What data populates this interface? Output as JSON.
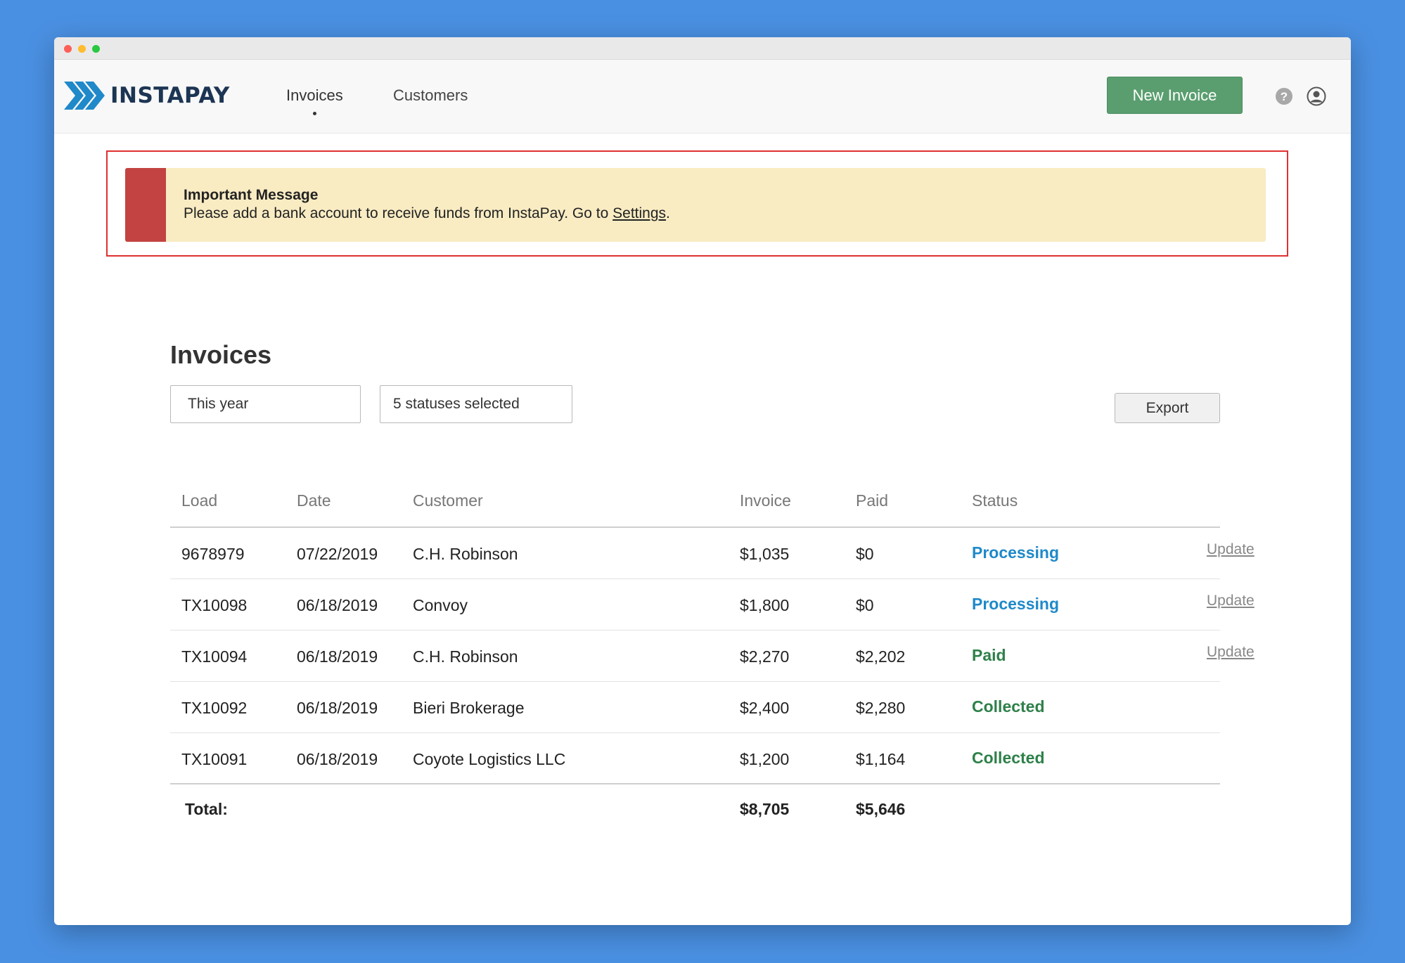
{
  "app": {
    "logo_text": "INSTAPAY",
    "brand_color": "#1c3553",
    "logo_arrow_color": "#1f89c9"
  },
  "nav": {
    "items": [
      {
        "label": "Invoices",
        "active": true
      },
      {
        "label": "Customers",
        "active": false
      }
    ]
  },
  "header": {
    "new_invoice_label": "New Invoice",
    "new_invoice_color": "#5a9e6f",
    "help_icon": "question-circle-icon",
    "user_icon": "user-circle-icon"
  },
  "alert": {
    "title": "Important Message",
    "body_prefix": "Please add a bank account to receive funds from InstaPay. Go to ",
    "link_text": "Settings",
    "body_suffix": ".",
    "accent_color": "#c24341",
    "background_color": "#f9ecc3"
  },
  "invoices": {
    "title": "Invoices",
    "filters": {
      "date_range": "This year",
      "statuses": "5 statuses selected"
    },
    "export_label": "Export",
    "columns": {
      "load": "Load",
      "date": "Date",
      "customer": "Customer",
      "invoice": "Invoice",
      "paid": "Paid",
      "status": "Status"
    },
    "rows": [
      {
        "load": "9678979",
        "date": "07/22/2019",
        "customer": "C.H. Robinson",
        "invoice": "$1,035",
        "paid": "$0",
        "status": "Processing",
        "update": "Update"
      },
      {
        "load": "TX10098",
        "date": "06/18/2019",
        "customer": "Convoy",
        "invoice": "$1,800",
        "paid": "$0",
        "status": "Processing",
        "update": "Update"
      },
      {
        "load": "TX10094",
        "date": "06/18/2019",
        "customer": "C.H. Robinson",
        "invoice": "$2,270",
        "paid": "$2,202",
        "status": "Paid",
        "update": "Update"
      },
      {
        "load": "TX10092",
        "date": "06/18/2019",
        "customer": "Bieri Brokerage",
        "invoice": "$2,400",
        "paid": "$2,280",
        "status": "Collected",
        "update": ""
      },
      {
        "load": "TX10091",
        "date": "06/18/2019",
        "customer": "Coyote Logistics LLC",
        "invoice": "$1,200",
        "paid": "$1,164",
        "status": "Collected",
        "update": ""
      }
    ],
    "total": {
      "label": "Total:",
      "invoice": "$8,705",
      "paid": "$5,646"
    },
    "status_colors": {
      "Processing": "#1f89c9",
      "Paid": "#2e8049",
      "Collected": "#2e8049"
    }
  }
}
